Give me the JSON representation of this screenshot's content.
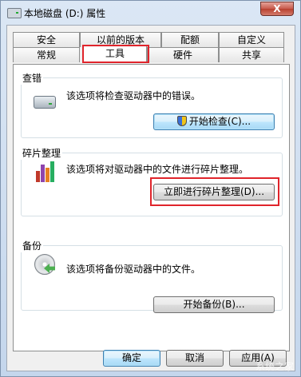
{
  "window": {
    "title": "本地磁盘 (D:) 属性",
    "close_label": "X"
  },
  "tabs_row1": [
    {
      "label": "安全"
    },
    {
      "label": "以前的版本"
    },
    {
      "label": "配额"
    },
    {
      "label": "自定义"
    }
  ],
  "tabs_row2": [
    {
      "label": "常规"
    },
    {
      "label": "工具"
    },
    {
      "label": "硬件"
    },
    {
      "label": "共享"
    }
  ],
  "active_tab": "工具",
  "groups": {
    "check": {
      "title": "查错",
      "text": "该选项将检查驱动器中的错误。",
      "button": "开始检查(C)..."
    },
    "defrag": {
      "title": "碎片整理",
      "text": "该选项将对驱动器中的文件进行碎片整理。",
      "button": "立即进行碎片整理(D)..."
    },
    "backup": {
      "title": "备份",
      "text": "该选项将备份驱动器中的文件。",
      "button": "开始备份(B)..."
    }
  },
  "footer": {
    "ok": "确定",
    "cancel": "取消",
    "apply": "应用(A)"
  },
  "watermark": "系统之家",
  "icons": [
    "drive-icon",
    "defrag-icon",
    "backup-icon",
    "uac-shield-icon"
  ],
  "colors": {
    "highlight": "#e0242b",
    "accent": "#3c7fb1"
  }
}
